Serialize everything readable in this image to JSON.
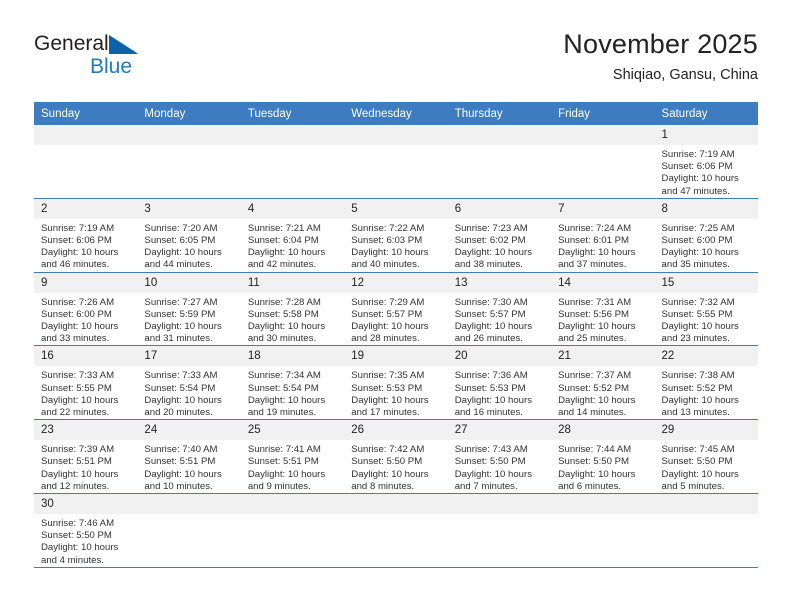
{
  "brand": {
    "name_part1": "General",
    "name_part2": "Blue",
    "flag_icon": "triangle-flag-icon",
    "accent_color": "#1e7bc4"
  },
  "header": {
    "title": "November 2025",
    "subtitle": "Shiqiao, Gansu, China"
  },
  "calendar": {
    "header_color": "#3d7cc0",
    "daynum_bg": "#f1f1f1",
    "weekdays": [
      "Sunday",
      "Monday",
      "Tuesday",
      "Wednesday",
      "Thursday",
      "Friday",
      "Saturday"
    ],
    "labels": {
      "sunrise": "Sunrise:",
      "sunset": "Sunset:",
      "daylight": "Daylight:"
    },
    "weeks": [
      [
        {
          "day": "",
          "empty": true
        },
        {
          "day": "",
          "empty": true
        },
        {
          "day": "",
          "empty": true
        },
        {
          "day": "",
          "empty": true
        },
        {
          "day": "",
          "empty": true
        },
        {
          "day": "",
          "empty": true
        },
        {
          "day": "1",
          "sunrise": "Sunrise: 7:19 AM",
          "sunset": "Sunset: 6:06 PM",
          "daylight": "Daylight: 10 hours and 47 minutes."
        }
      ],
      [
        {
          "day": "2",
          "sunrise": "Sunrise: 7:19 AM",
          "sunset": "Sunset: 6:06 PM",
          "daylight": "Daylight: 10 hours and 46 minutes."
        },
        {
          "day": "3",
          "sunrise": "Sunrise: 7:20 AM",
          "sunset": "Sunset: 6:05 PM",
          "daylight": "Daylight: 10 hours and 44 minutes."
        },
        {
          "day": "4",
          "sunrise": "Sunrise: 7:21 AM",
          "sunset": "Sunset: 6:04 PM",
          "daylight": "Daylight: 10 hours and 42 minutes."
        },
        {
          "day": "5",
          "sunrise": "Sunrise: 7:22 AM",
          "sunset": "Sunset: 6:03 PM",
          "daylight": "Daylight: 10 hours and 40 minutes."
        },
        {
          "day": "6",
          "sunrise": "Sunrise: 7:23 AM",
          "sunset": "Sunset: 6:02 PM",
          "daylight": "Daylight: 10 hours and 38 minutes."
        },
        {
          "day": "7",
          "sunrise": "Sunrise: 7:24 AM",
          "sunset": "Sunset: 6:01 PM",
          "daylight": "Daylight: 10 hours and 37 minutes."
        },
        {
          "day": "8",
          "sunrise": "Sunrise: 7:25 AM",
          "sunset": "Sunset: 6:00 PM",
          "daylight": "Daylight: 10 hours and 35 minutes."
        }
      ],
      [
        {
          "day": "9",
          "sunrise": "Sunrise: 7:26 AM",
          "sunset": "Sunset: 6:00 PM",
          "daylight": "Daylight: 10 hours and 33 minutes."
        },
        {
          "day": "10",
          "sunrise": "Sunrise: 7:27 AM",
          "sunset": "Sunset: 5:59 PM",
          "daylight": "Daylight: 10 hours and 31 minutes."
        },
        {
          "day": "11",
          "sunrise": "Sunrise: 7:28 AM",
          "sunset": "Sunset: 5:58 PM",
          "daylight": "Daylight: 10 hours and 30 minutes."
        },
        {
          "day": "12",
          "sunrise": "Sunrise: 7:29 AM",
          "sunset": "Sunset: 5:57 PM",
          "daylight": "Daylight: 10 hours and 28 minutes."
        },
        {
          "day": "13",
          "sunrise": "Sunrise: 7:30 AM",
          "sunset": "Sunset: 5:57 PM",
          "daylight": "Daylight: 10 hours and 26 minutes."
        },
        {
          "day": "14",
          "sunrise": "Sunrise: 7:31 AM",
          "sunset": "Sunset: 5:56 PM",
          "daylight": "Daylight: 10 hours and 25 minutes."
        },
        {
          "day": "15",
          "sunrise": "Sunrise: 7:32 AM",
          "sunset": "Sunset: 5:55 PM",
          "daylight": "Daylight: 10 hours and 23 minutes."
        }
      ],
      [
        {
          "day": "16",
          "sunrise": "Sunrise: 7:33 AM",
          "sunset": "Sunset: 5:55 PM",
          "daylight": "Daylight: 10 hours and 22 minutes."
        },
        {
          "day": "17",
          "sunrise": "Sunrise: 7:33 AM",
          "sunset": "Sunset: 5:54 PM",
          "daylight": "Daylight: 10 hours and 20 minutes."
        },
        {
          "day": "18",
          "sunrise": "Sunrise: 7:34 AM",
          "sunset": "Sunset: 5:54 PM",
          "daylight": "Daylight: 10 hours and 19 minutes."
        },
        {
          "day": "19",
          "sunrise": "Sunrise: 7:35 AM",
          "sunset": "Sunset: 5:53 PM",
          "daylight": "Daylight: 10 hours and 17 minutes."
        },
        {
          "day": "20",
          "sunrise": "Sunrise: 7:36 AM",
          "sunset": "Sunset: 5:53 PM",
          "daylight": "Daylight: 10 hours and 16 minutes."
        },
        {
          "day": "21",
          "sunrise": "Sunrise: 7:37 AM",
          "sunset": "Sunset: 5:52 PM",
          "daylight": "Daylight: 10 hours and 14 minutes."
        },
        {
          "day": "22",
          "sunrise": "Sunrise: 7:38 AM",
          "sunset": "Sunset: 5:52 PM",
          "daylight": "Daylight: 10 hours and 13 minutes."
        }
      ],
      [
        {
          "day": "23",
          "sunrise": "Sunrise: 7:39 AM",
          "sunset": "Sunset: 5:51 PM",
          "daylight": "Daylight: 10 hours and 12 minutes."
        },
        {
          "day": "24",
          "sunrise": "Sunrise: 7:40 AM",
          "sunset": "Sunset: 5:51 PM",
          "daylight": "Daylight: 10 hours and 10 minutes."
        },
        {
          "day": "25",
          "sunrise": "Sunrise: 7:41 AM",
          "sunset": "Sunset: 5:51 PM",
          "daylight": "Daylight: 10 hours and 9 minutes."
        },
        {
          "day": "26",
          "sunrise": "Sunrise: 7:42 AM",
          "sunset": "Sunset: 5:50 PM",
          "daylight": "Daylight: 10 hours and 8 minutes."
        },
        {
          "day": "27",
          "sunrise": "Sunrise: 7:43 AM",
          "sunset": "Sunset: 5:50 PM",
          "daylight": "Daylight: 10 hours and 7 minutes."
        },
        {
          "day": "28",
          "sunrise": "Sunrise: 7:44 AM",
          "sunset": "Sunset: 5:50 PM",
          "daylight": "Daylight: 10 hours and 6 minutes."
        },
        {
          "day": "29",
          "sunrise": "Sunrise: 7:45 AM",
          "sunset": "Sunset: 5:50 PM",
          "daylight": "Daylight: 10 hours and 5 minutes."
        }
      ],
      [
        {
          "day": "30",
          "sunrise": "Sunrise: 7:46 AM",
          "sunset": "Sunset: 5:50 PM",
          "daylight": "Daylight: 10 hours and 4 minutes."
        },
        {
          "day": "",
          "empty": true
        },
        {
          "day": "",
          "empty": true
        },
        {
          "day": "",
          "empty": true
        },
        {
          "day": "",
          "empty": true
        },
        {
          "day": "",
          "empty": true
        },
        {
          "day": "",
          "empty": true
        }
      ]
    ]
  }
}
